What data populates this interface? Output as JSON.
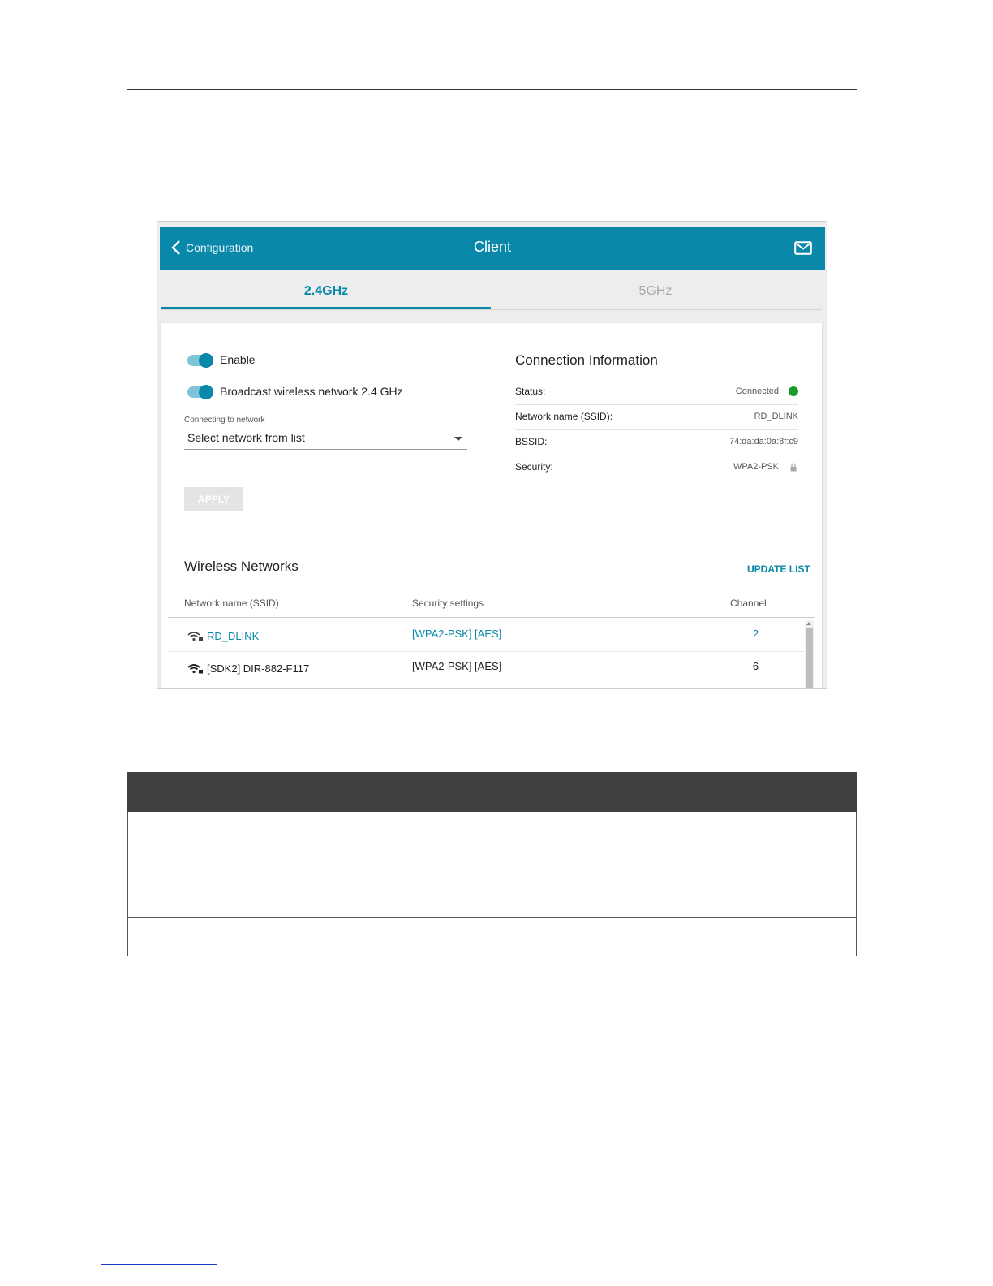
{
  "header": {
    "back_label": "Configuration",
    "title": "Client"
  },
  "tabs": [
    {
      "label": "2.4GHz",
      "active": true
    },
    {
      "label": "5GHz",
      "active": false
    }
  ],
  "settings": {
    "enable_label": "Enable",
    "enable_on": true,
    "broadcast_label": "Broadcast wireless network 2.4 GHz",
    "broadcast_on": true,
    "network_select_caption": "Connecting to network",
    "network_select_value": "Select network from list",
    "apply_label": "APPLY"
  },
  "connection_info": {
    "title": "Connection Information",
    "rows": [
      {
        "label": "Status:",
        "value": "Connected"
      },
      {
        "label": "Network name (SSID):",
        "value": "RD_DLINK"
      },
      {
        "label": "BSSID:",
        "value": "74:da:da:0a:8f:c9"
      },
      {
        "label": "Security:",
        "value": "WPA2-PSK"
      }
    ]
  },
  "wireless_networks": {
    "title": "Wireless Networks",
    "update_label": "UPDATE LIST",
    "columns": [
      "Network name (SSID)",
      "Security settings",
      "Channel"
    ],
    "rows": [
      {
        "ssid": "RD_DLINK",
        "security": "[WPA2-PSK] [AES]",
        "channel": "2",
        "connected": true
      },
      {
        "ssid": "[SDK2] DIR-882-F117",
        "security": "[WPA2-PSK] [AES]",
        "channel": "6",
        "connected": false
      }
    ]
  },
  "colors": {
    "accent": "#0a88aa",
    "status_ok": "#1a9a2a",
    "table_header": "#404040"
  }
}
